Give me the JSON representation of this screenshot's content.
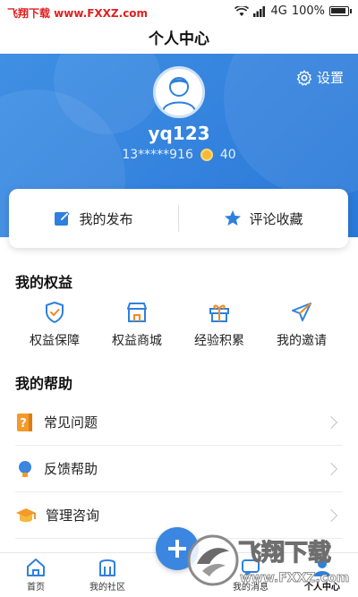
{
  "status_bar": {
    "watermark": "飞翔下载 www.FXXZ.com",
    "signal": "4G",
    "battery": "100%"
  },
  "page_title": "个人中心",
  "header": {
    "settings_label": "设置",
    "username": "yq123",
    "phone": "13*****916",
    "coins": "40",
    "accent": "#2f80dc"
  },
  "card": {
    "my_posts": "我的发布",
    "comments_favorites": "评论收藏"
  },
  "benefits_section": {
    "title": "我的权益",
    "items": [
      {
        "label": "权益保障",
        "icon": "shield-check-icon"
      },
      {
        "label": "权益商城",
        "icon": "store-icon"
      },
      {
        "label": "经验积累",
        "icon": "gift-icon"
      },
      {
        "label": "我的邀请",
        "icon": "send-icon"
      }
    ]
  },
  "help_section": {
    "title": "我的帮助",
    "items": [
      {
        "label": "常见问题",
        "icon": "question-book-icon"
      },
      {
        "label": "反馈帮助",
        "icon": "lightbulb-icon"
      },
      {
        "label": "管理咨询",
        "icon": "graduation-cap-icon"
      }
    ]
  },
  "tabbar": {
    "items": [
      {
        "label": "首页",
        "icon": "home-icon"
      },
      {
        "label": "我的社区",
        "icon": "community-icon"
      },
      {
        "label": "",
        "icon": "add-icon"
      },
      {
        "label": "我的消息",
        "icon": "message-icon"
      },
      {
        "label": "个人中心",
        "icon": "user-icon"
      }
    ]
  },
  "watermark_logo": {
    "text": "飞翔下载",
    "url": "www.FXXZ.com"
  }
}
